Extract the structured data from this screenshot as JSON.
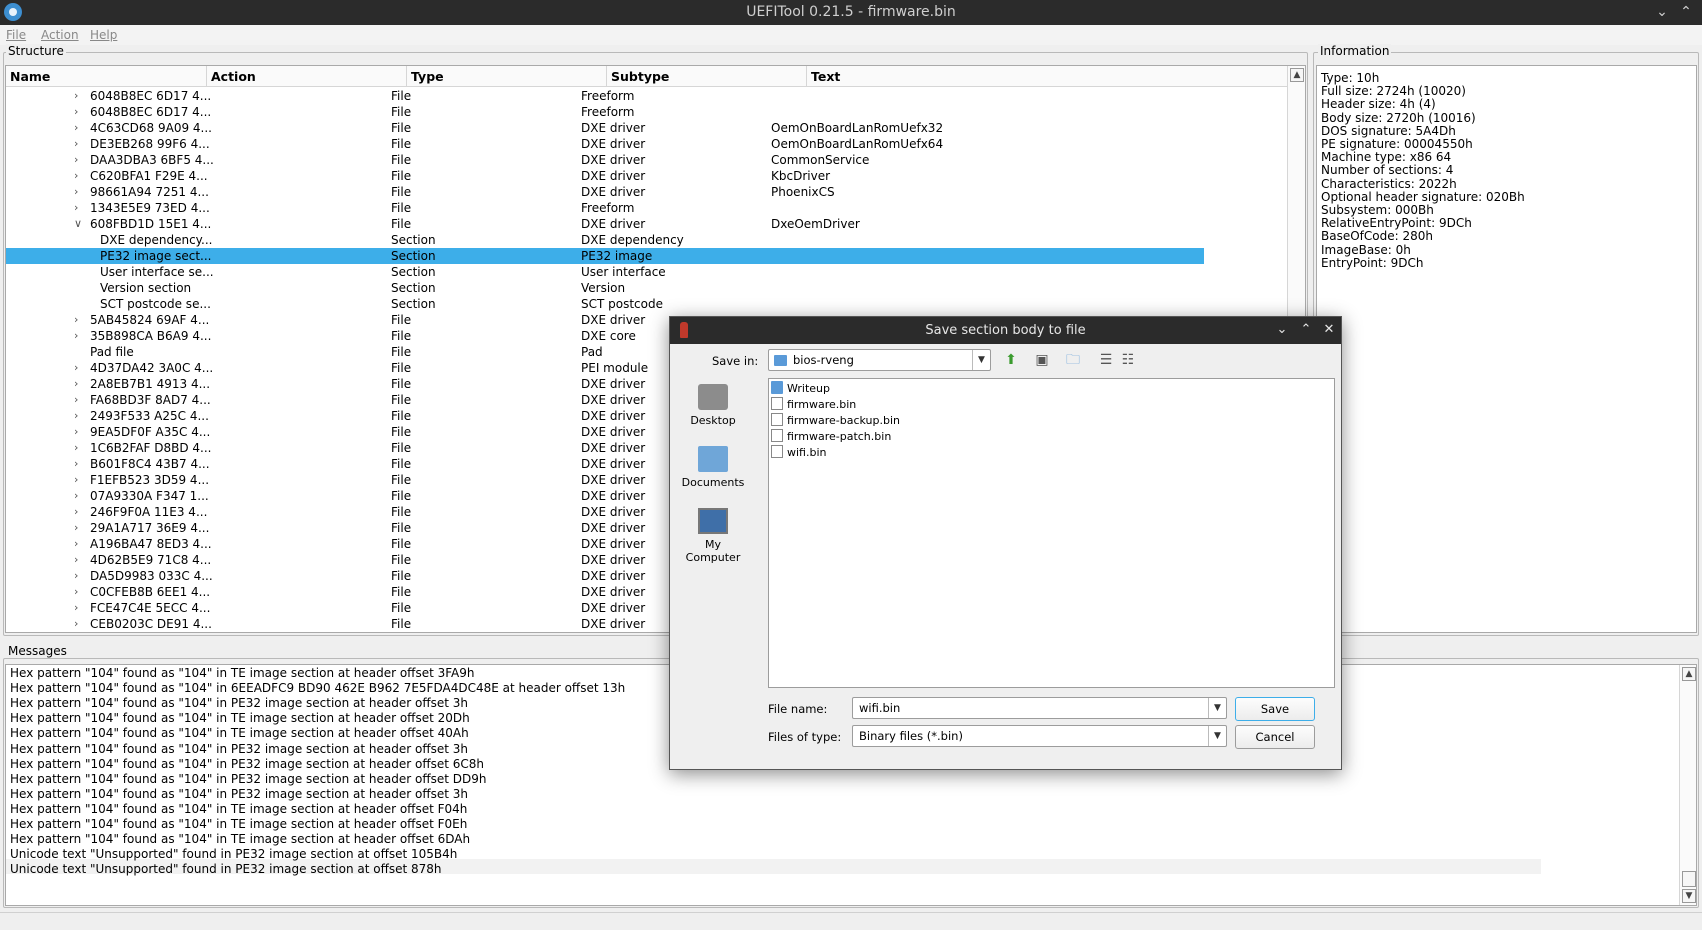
{
  "window": {
    "title": "UEFITool 0.21.5 - firmware.bin"
  },
  "menu": [
    "File",
    "Action",
    "Help"
  ],
  "structure": {
    "group_label": "Structure",
    "columns": [
      "Name",
      "Action",
      "Type",
      "Subtype",
      "Text"
    ],
    "rows": [
      {
        "name": "6048B8EC 6D17 4...",
        "type": "File",
        "subtype": "Freeform",
        "text": "",
        "arrow": ">",
        "indent": 1
      },
      {
        "name": "6048B8EC 6D17 4...",
        "type": "File",
        "subtype": "Freeform",
        "text": "",
        "arrow": ">",
        "indent": 1
      },
      {
        "name": "4C63CD68 9A09 4...",
        "type": "File",
        "subtype": "DXE driver",
        "text": "OemOnBoardLanRomUefx32",
        "arrow": ">",
        "indent": 1
      },
      {
        "name": "DE3EB268 99F6 4...",
        "type": "File",
        "subtype": "DXE driver",
        "text": "OemOnBoardLanRomUefx64",
        "arrow": ">",
        "indent": 1
      },
      {
        "name": "DAA3DBA3 6BF5 4...",
        "type": "File",
        "subtype": "DXE driver",
        "text": "CommonService",
        "arrow": ">",
        "indent": 1
      },
      {
        "name": "C620BFA1 F29E 4...",
        "type": "File",
        "subtype": "DXE driver",
        "text": "KbcDriver",
        "arrow": ">",
        "indent": 1
      },
      {
        "name": "98661A94 7251 4...",
        "type": "File",
        "subtype": "DXE driver",
        "text": "PhoenixCS",
        "arrow": ">",
        "indent": 1
      },
      {
        "name": "1343E5E9 73ED 4...",
        "type": "File",
        "subtype": "Freeform",
        "text": "",
        "arrow": ">",
        "indent": 1
      },
      {
        "name": "608FBD1D 15E1 4...",
        "type": "File",
        "subtype": "DXE driver",
        "text": "DxeOemDriver",
        "arrow": "v",
        "indent": 1
      },
      {
        "name": "DXE dependency...",
        "type": "Section",
        "subtype": "DXE dependency",
        "text": "",
        "arrow": "",
        "indent": 2
      },
      {
        "name": "PE32 image sect...",
        "type": "Section",
        "subtype": "PE32 image",
        "text": "",
        "arrow": "",
        "indent": 2,
        "selected": true
      },
      {
        "name": "User interface se...",
        "type": "Section",
        "subtype": "User interface",
        "text": "",
        "arrow": "",
        "indent": 2
      },
      {
        "name": "Version section",
        "type": "Section",
        "subtype": "Version",
        "text": "",
        "arrow": "",
        "indent": 2
      },
      {
        "name": "SCT postcode se...",
        "type": "Section",
        "subtype": "SCT postcode",
        "text": "",
        "arrow": "",
        "indent": 2
      },
      {
        "name": "5AB45824 69AF 4...",
        "type": "File",
        "subtype": "DXE driver",
        "text": "",
        "arrow": ">",
        "indent": 1
      },
      {
        "name": "35B898CA B6A9 4...",
        "type": "File",
        "subtype": "DXE core",
        "text": "",
        "arrow": ">",
        "indent": 1
      },
      {
        "name": "Pad file",
        "type": "File",
        "subtype": "Pad",
        "text": "",
        "arrow": "",
        "indent": 1
      },
      {
        "name": "4D37DA42 3A0C 4...",
        "type": "File",
        "subtype": "PEI module",
        "text": "",
        "arrow": ">",
        "indent": 1
      },
      {
        "name": "2A8EB7B1 4913 4...",
        "type": "File",
        "subtype": "DXE driver",
        "text": "",
        "arrow": ">",
        "indent": 1
      },
      {
        "name": "FA68BD3F 8AD7 4...",
        "type": "File",
        "subtype": "DXE driver",
        "text": "",
        "arrow": ">",
        "indent": 1
      },
      {
        "name": "2493F533 A25C 4...",
        "type": "File",
        "subtype": "DXE driver",
        "text": "",
        "arrow": ">",
        "indent": 1
      },
      {
        "name": "9EA5DF0F A35C 4...",
        "type": "File",
        "subtype": "DXE driver",
        "text": "",
        "arrow": ">",
        "indent": 1
      },
      {
        "name": "1C6B2FAF D8BD 4...",
        "type": "File",
        "subtype": "DXE driver",
        "text": "",
        "arrow": ">",
        "indent": 1
      },
      {
        "name": "B601F8C4 43B7 4...",
        "type": "File",
        "subtype": "DXE driver",
        "text": "",
        "arrow": ">",
        "indent": 1
      },
      {
        "name": "F1EFB523 3D59 4...",
        "type": "File",
        "subtype": "DXE driver",
        "text": "",
        "arrow": ">",
        "indent": 1
      },
      {
        "name": "07A9330A F347 1...",
        "type": "File",
        "subtype": "DXE driver",
        "text": "",
        "arrow": ">",
        "indent": 1
      },
      {
        "name": "246F9F0A 11E3 4...",
        "type": "File",
        "subtype": "DXE driver",
        "text": "",
        "arrow": ">",
        "indent": 1
      },
      {
        "name": "29A1A717 36E9 4...",
        "type": "File",
        "subtype": "DXE driver",
        "text": "",
        "arrow": ">",
        "indent": 1
      },
      {
        "name": "A196BA47 8ED3 4...",
        "type": "File",
        "subtype": "DXE driver",
        "text": "",
        "arrow": ">",
        "indent": 1
      },
      {
        "name": "4D62B5E9 71C8 4...",
        "type": "File",
        "subtype": "DXE driver",
        "text": "",
        "arrow": ">",
        "indent": 1
      },
      {
        "name": "DA5D9983 033C 4...",
        "type": "File",
        "subtype": "DXE driver",
        "text": "",
        "arrow": ">",
        "indent": 1
      },
      {
        "name": "C0CFEB8B 6EE1 4...",
        "type": "File",
        "subtype": "DXE driver",
        "text": "",
        "arrow": ">",
        "indent": 1
      },
      {
        "name": "FCE47C4E 5ECC 4...",
        "type": "File",
        "subtype": "DXE driver",
        "text": "",
        "arrow": ">",
        "indent": 1
      },
      {
        "name": "CEB0203C DE91 4...",
        "type": "File",
        "subtype": "DXE driver",
        "text": "",
        "arrow": ">",
        "indent": 1
      }
    ]
  },
  "information": {
    "group_label": "Information",
    "lines": [
      "Type: 10h",
      "Full size: 2724h (10020)",
      "Header size: 4h (4)",
      "Body size: 2720h (10016)",
      "DOS signature: 5A4Dh",
      "PE signature: 00004550h",
      "Machine type: x86 64",
      "Number of sections: 4",
      "Characteristics: 2022h",
      "Optional header signature: 020Bh",
      "Subsystem: 000Bh",
      "RelativeEntryPoint: 9DCh",
      "BaseOfCode: 280h",
      "ImageBase: 0h",
      "EntryPoint: 9DCh"
    ]
  },
  "messages": {
    "group_label": "Messages",
    "lines": [
      "Hex pattern \"104\" found as \"104\" in TE image section at header offset 3FA9h",
      "Hex pattern \"104\" found as \"104\" in 6EEADFC9 BD90 462E B962 7E5FDA4DC48E at header offset 13h",
      "Hex pattern \"104\" found as \"104\" in PE32 image section at header offset 3h",
      "Hex pattern \"104\" found as \"104\" in TE image section at header offset 20Dh",
      "Hex pattern \"104\" found as \"104\" in TE image section at header offset 40Ah",
      "Hex pattern \"104\" found as \"104\" in PE32 image section at header offset 3h",
      "Hex pattern \"104\" found as \"104\" in PE32 image section at header offset 6C8h",
      "Hex pattern \"104\" found as \"104\" in PE32 image section at header offset DD9h",
      "Hex pattern \"104\" found as \"104\" in PE32 image section at header offset 3h",
      "Hex pattern \"104\" found as \"104\" in TE image section at header offset F04h",
      "Hex pattern \"104\" found as \"104\" in TE image section at header offset F0Eh",
      "Hex pattern \"104\" found as \"104\" in TE image section at header offset 6DAh",
      "Unicode text \"Unsupported\" found in PE32 image section at offset 105B4h",
      "Unicode text \"Unsupported\" found in PE32 image section at offset 878h"
    ]
  },
  "dialog": {
    "title": "Save section body to file",
    "save_in_label": "Save in:",
    "save_in_value": "bios-rveng",
    "places": [
      "Desktop",
      "Documents",
      "My Computer"
    ],
    "files": [
      {
        "name": "Writeup",
        "kind": "folder"
      },
      {
        "name": "firmware.bin",
        "kind": "file"
      },
      {
        "name": "firmware-backup.bin",
        "kind": "file"
      },
      {
        "name": "firmware-patch.bin",
        "kind": "file"
      },
      {
        "name": "wifi.bin",
        "kind": "file"
      }
    ],
    "file_name_label": "File name:",
    "file_name_value": "wifi.bin",
    "files_of_type_label": "Files of type:",
    "files_of_type_value": "Binary files (*.bin)",
    "save_label": "Save",
    "cancel_label": "Cancel"
  }
}
